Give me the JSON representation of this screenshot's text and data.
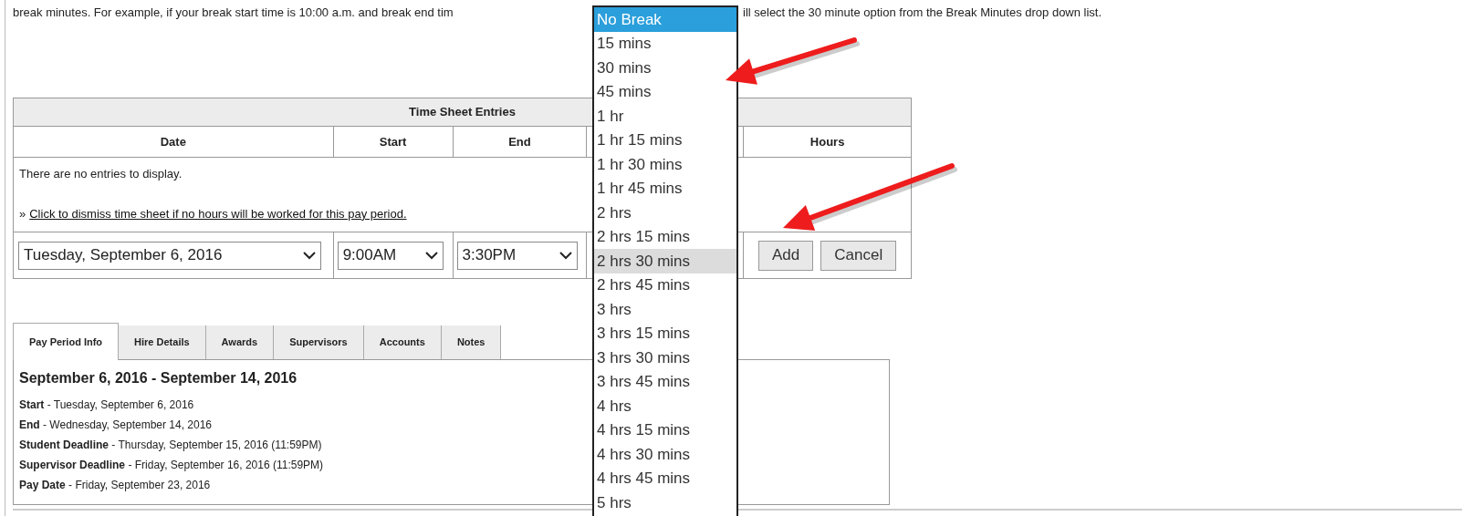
{
  "intro_text": "break minutes. For example, if your break start time is 10:00 a.m. and break end tim",
  "intro_text_after": "ill select the 30 minute option from the Break Minutes drop down list.",
  "table": {
    "title": "Time Sheet Entries",
    "columns": [
      "Date",
      "Start",
      "End",
      "Hours"
    ],
    "empty_message": "There are no entries to display.",
    "dismiss_prefix": "»",
    "dismiss_link": "Click to dismiss time sheet if no hours will be worked for this pay period.",
    "entry": {
      "date": "Tuesday, September 6, 2016",
      "start": "9:00AM",
      "end": "3:30PM"
    },
    "buttons": [
      "Add",
      "Cancel"
    ]
  },
  "tabs": [
    {
      "label": "Pay Period Info",
      "selected": true
    },
    {
      "label": "Hire Details",
      "selected": false
    },
    {
      "label": "Awards",
      "selected": false
    },
    {
      "label": "Supervisors",
      "selected": false
    },
    {
      "label": "Accounts",
      "selected": false
    },
    {
      "label": "Notes",
      "selected": false
    }
  ],
  "pay_period": {
    "heading": "September 6, 2016 - September 14, 2016",
    "separator": "-",
    "details": [
      {
        "label": "Start",
        "value": "Tuesday, September 6, 2016"
      },
      {
        "label": "End",
        "value": "Wednesday, September 14, 2016"
      },
      {
        "label": "Student Deadline",
        "value": "Thursday, September 15, 2016 (11:59PM)"
      },
      {
        "label": "Supervisor Deadline",
        "value": "Friday, September 16, 2016 (11:59PM)"
      },
      {
        "label": "Pay Date",
        "value": "Friday, September 23, 2016"
      }
    ]
  },
  "break_dropdown": {
    "options": [
      {
        "label": "No Break",
        "selected": true,
        "highlighted": false
      },
      {
        "label": "15 mins",
        "selected": false,
        "highlighted": false
      },
      {
        "label": "30 mins",
        "selected": false,
        "highlighted": false
      },
      {
        "label": "45 mins",
        "selected": false,
        "highlighted": false
      },
      {
        "label": "1 hr",
        "selected": false,
        "highlighted": false
      },
      {
        "label": "1 hr 15 mins",
        "selected": false,
        "highlighted": false
      },
      {
        "label": "1 hr 30 mins",
        "selected": false,
        "highlighted": false
      },
      {
        "label": "1 hr 45 mins",
        "selected": false,
        "highlighted": false
      },
      {
        "label": "2 hrs",
        "selected": false,
        "highlighted": false
      },
      {
        "label": "2 hrs 15 mins",
        "selected": false,
        "highlighted": false
      },
      {
        "label": "2 hrs 30 mins",
        "selected": false,
        "highlighted": true
      },
      {
        "label": "2 hrs 45 mins",
        "selected": false,
        "highlighted": false
      },
      {
        "label": "3 hrs",
        "selected": false,
        "highlighted": false
      },
      {
        "label": "3 hrs 15 mins",
        "selected": false,
        "highlighted": false
      },
      {
        "label": "3 hrs 30 mins",
        "selected": false,
        "highlighted": false
      },
      {
        "label": "3 hrs 45 mins",
        "selected": false,
        "highlighted": false
      },
      {
        "label": "4 hrs",
        "selected": false,
        "highlighted": false
      },
      {
        "label": "4 hrs 15 mins",
        "selected": false,
        "highlighted": false
      },
      {
        "label": "4 hrs 30 mins",
        "selected": false,
        "highlighted": false
      },
      {
        "label": "4 hrs 45 mins",
        "selected": false,
        "highlighted": false
      },
      {
        "label": "5 hrs",
        "selected": false,
        "highlighted": false
      }
    ]
  }
}
